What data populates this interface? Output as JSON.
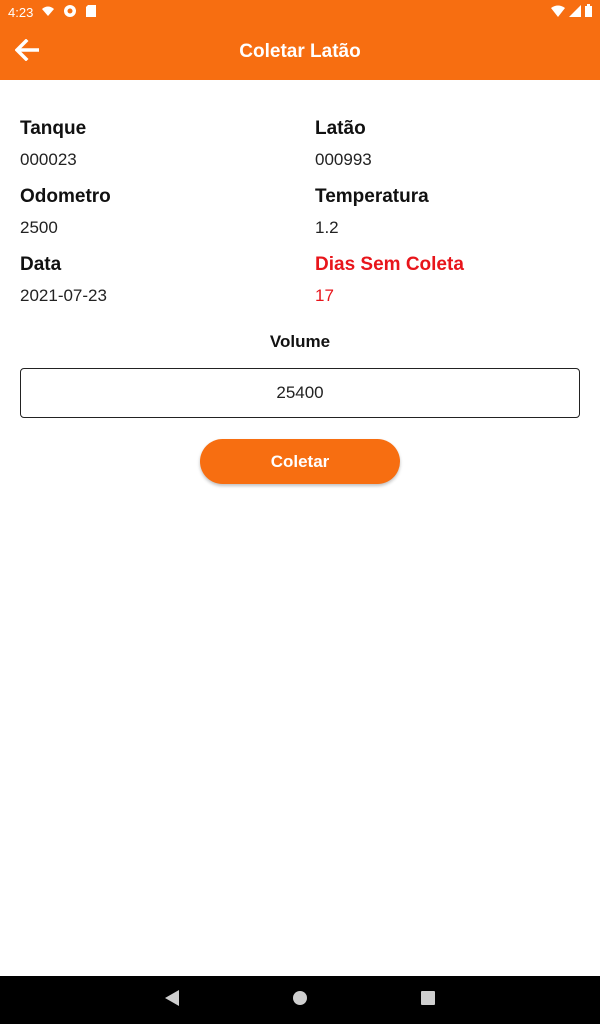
{
  "status_bar": {
    "time": "4:23",
    "left_icons": [
      "wifi-calling-icon",
      "app-notification-icon",
      "sd-card-icon"
    ],
    "right_icons": [
      "wifi-icon",
      "signal-icon",
      "battery-icon"
    ]
  },
  "app_bar": {
    "title": "Coletar Latão",
    "back_icon": "arrow-back-icon"
  },
  "fields": {
    "tanque": {
      "label": "Tanque",
      "value": "000023"
    },
    "latao": {
      "label": "Latão",
      "value": "000993"
    },
    "odometro": {
      "label": "Odometro",
      "value": "2500"
    },
    "temperatura": {
      "label": "Temperatura",
      "value": "1.2"
    },
    "data": {
      "label": "Data",
      "value": "2021-07-23"
    },
    "dias_sem_coleta": {
      "label": "Dias Sem Coleta",
      "value": "17"
    }
  },
  "volume": {
    "label": "Volume",
    "value": "25400"
  },
  "actions": {
    "collect_label": "Coletar"
  },
  "colors": {
    "primary": "#f76e11",
    "alert": "#e8151b"
  },
  "nav_bar": {
    "buttons": [
      "back-triangle-icon",
      "home-circle-icon",
      "recents-square-icon"
    ]
  }
}
